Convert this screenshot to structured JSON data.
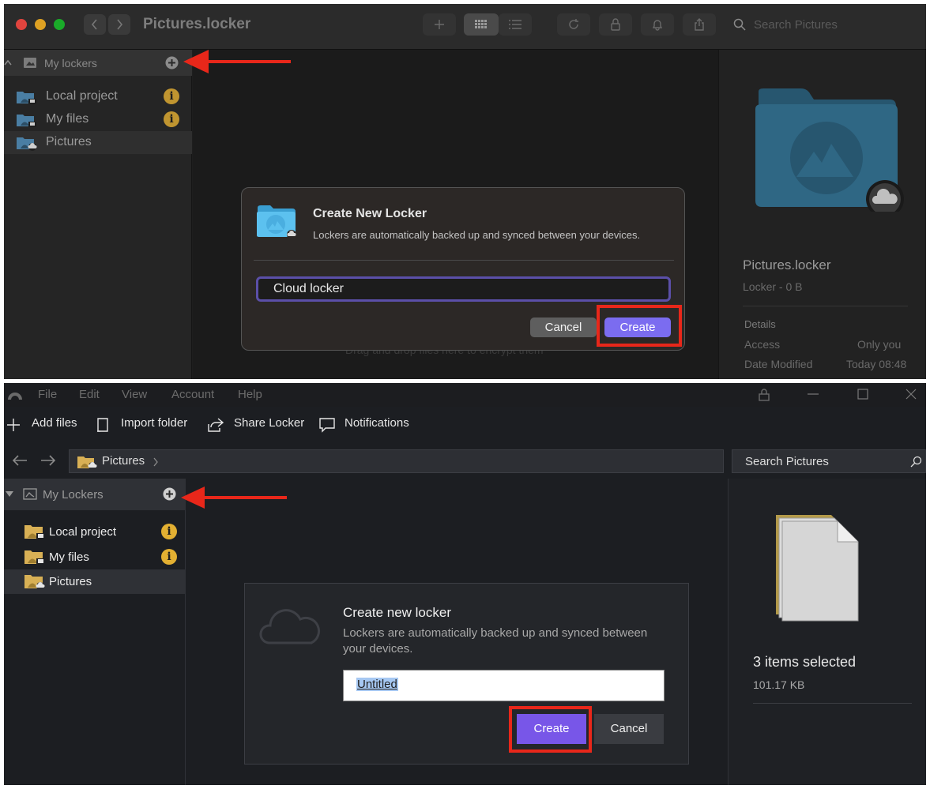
{
  "mac": {
    "window_title": "Pictures.locker",
    "search_placeholder": "Search Pictures",
    "sidebar": {
      "header_label": "My lockers",
      "items": [
        {
          "label": "Local project",
          "badge": "i"
        },
        {
          "label": "My files",
          "badge": "i"
        },
        {
          "label": "Pictures"
        }
      ]
    },
    "drop_hint": "Drag and drop files here to encrypt them",
    "details_panel": {
      "name": "Pictures.locker",
      "kind": "Locker - 0 B",
      "section_title": "Details",
      "rows": [
        {
          "label": "Access",
          "value": "Only you"
        },
        {
          "label": "Date Modified",
          "value": "Today 08:48"
        }
      ]
    },
    "dialog": {
      "title": "Create New Locker",
      "subtitle": "Lockers are automatically backed up and synced between your devices.",
      "input_value": "Cloud locker",
      "cancel_label": "Cancel",
      "create_label": "Create"
    }
  },
  "win": {
    "menu": [
      "File",
      "Edit",
      "View",
      "Account",
      "Help"
    ],
    "toolbar": {
      "add_files": "Add files",
      "import_folder": "Import folder",
      "share_locker": "Share Locker",
      "notifications": "Notifications"
    },
    "address_label": "Pictures",
    "search_placeholder": "Search Pictures",
    "sidebar": {
      "header_label": "My Lockers",
      "items": [
        {
          "label": "Local project",
          "badge": "i"
        },
        {
          "label": "My files",
          "badge": "i"
        },
        {
          "label": "Pictures"
        }
      ]
    },
    "details_panel": {
      "selection": "3 items selected",
      "size": "101.17 KB"
    },
    "dialog": {
      "title": "Create new locker",
      "subtitle": "Lockers are automatically backed up and synced between your devices.",
      "input_value": "Untitled",
      "create_label": "Create",
      "cancel_label": "Cancel"
    }
  },
  "colors": {
    "annotation_red": "#e8271a",
    "mac_accent": "#7b6cf0",
    "win_accent": "#7856e8",
    "info_badge": "#c09530"
  }
}
